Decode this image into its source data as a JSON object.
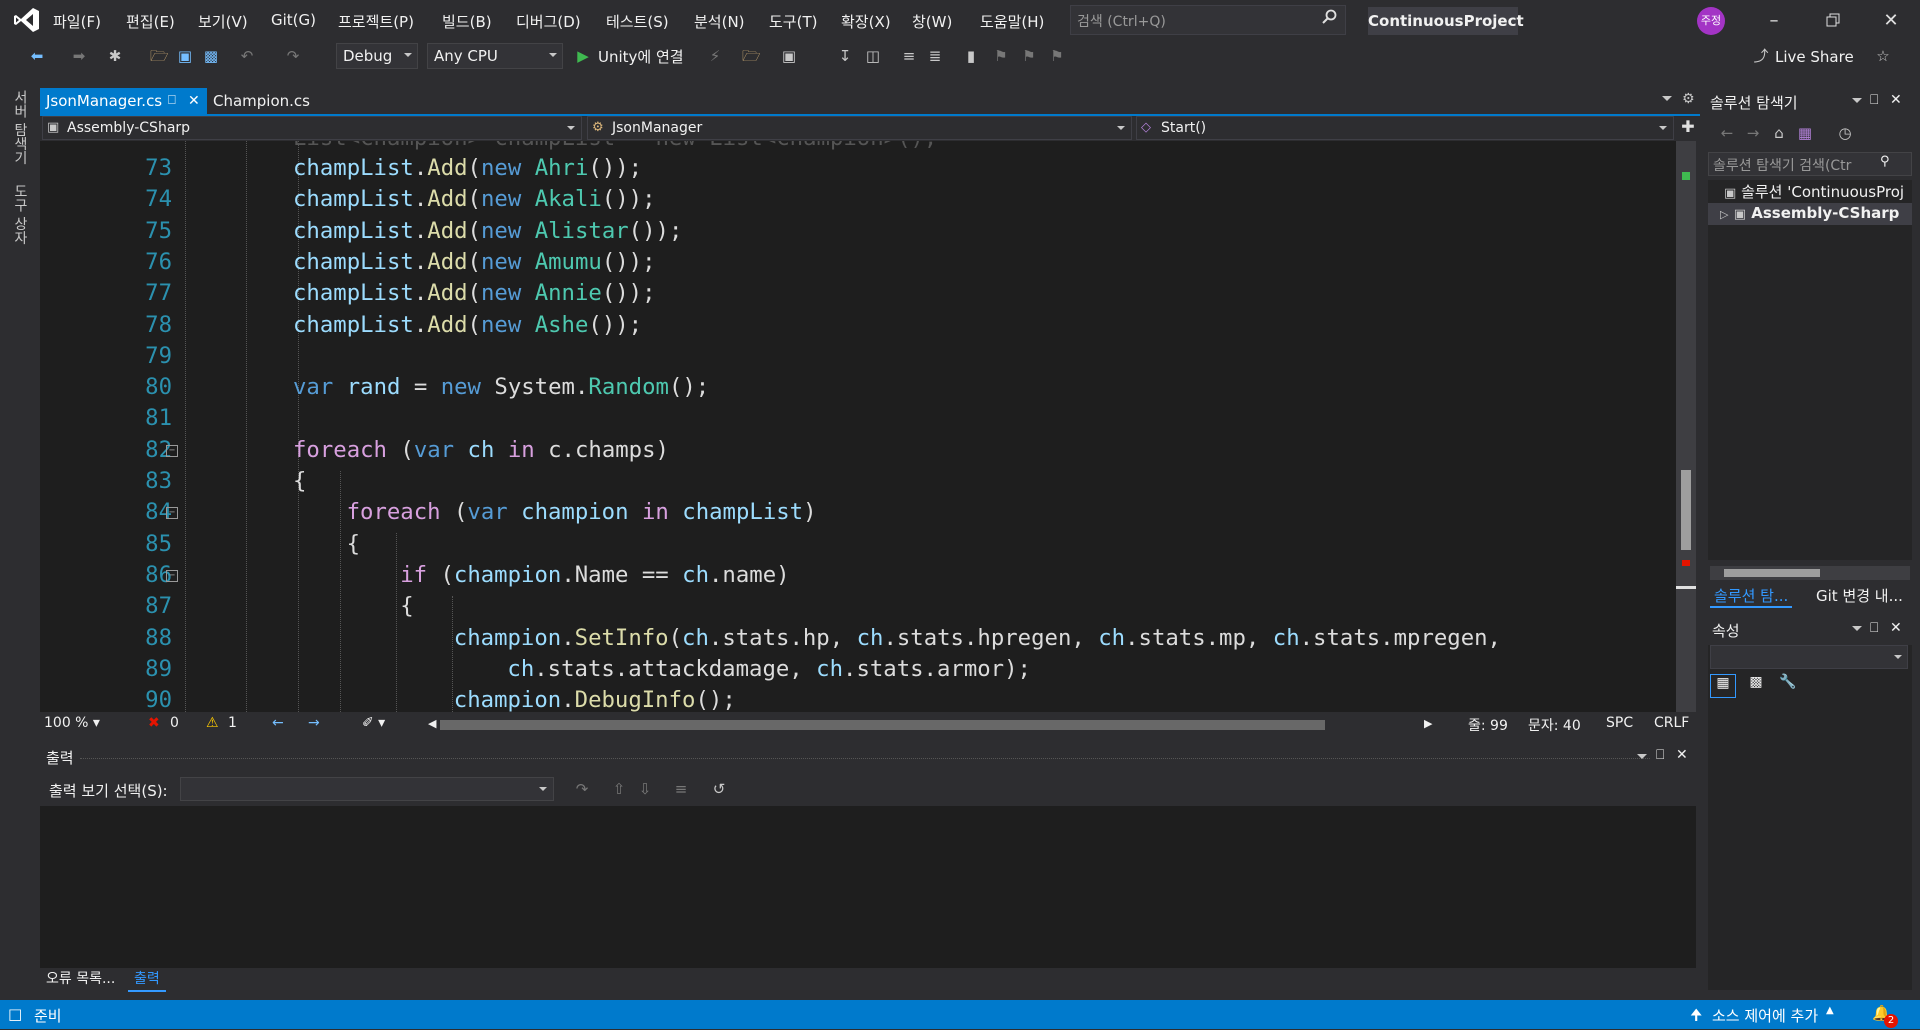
{
  "menu": [
    "파일(F)",
    "편집(E)",
    "보기(V)",
    "Git(G)",
    "프로젝트(P)",
    "빌드(B)",
    "디버그(D)",
    "테스트(S)",
    "분석(N)",
    "도구(T)",
    "확장(X)",
    "창(W)",
    "도움말(H)"
  ],
  "search": {
    "placeholder": "검색 (Ctrl+Q)"
  },
  "project_name": "ContinuousProject",
  "user_badge": "주정",
  "toolbar": {
    "config": "Debug",
    "platform": "Any CPU",
    "run_label": "Unity에 연결",
    "live_share": "Live Share"
  },
  "left_tabs": [
    "서버 탐색기",
    "도구 상자"
  ],
  "tabs": [
    {
      "label": "JsonManager.cs",
      "active": true
    },
    {
      "label": "Champion.cs",
      "active": false
    }
  ],
  "navbar": {
    "project": "Assembly-CSharp",
    "class": "JsonManager",
    "member": "Start()"
  },
  "code_lines": [
    {
      "num": "73",
      "indent": 0,
      "tokens": [
        [
          "champList",
          "loc"
        ],
        [
          ".",
          ""
        ],
        [
          "Add",
          "mth"
        ],
        [
          "(",
          ""
        ],
        [
          "new",
          "kw"
        ],
        [
          " ",
          ""
        ],
        [
          "Ahri",
          "typ"
        ],
        [
          "());",
          ""
        ]
      ]
    },
    {
      "num": "74",
      "indent": 0,
      "tokens": [
        [
          "champList",
          "loc"
        ],
        [
          ".",
          ""
        ],
        [
          "Add",
          "mth"
        ],
        [
          "(",
          ""
        ],
        [
          "new",
          "kw"
        ],
        [
          " ",
          ""
        ],
        [
          "Akali",
          "typ"
        ],
        [
          "());",
          ""
        ]
      ]
    },
    {
      "num": "75",
      "indent": 0,
      "tokens": [
        [
          "champList",
          "loc"
        ],
        [
          ".",
          ""
        ],
        [
          "Add",
          "mth"
        ],
        [
          "(",
          ""
        ],
        [
          "new",
          "kw"
        ],
        [
          " ",
          ""
        ],
        [
          "Alistar",
          "typ"
        ],
        [
          "());",
          ""
        ]
      ]
    },
    {
      "num": "76",
      "indent": 0,
      "tokens": [
        [
          "champList",
          "loc"
        ],
        [
          ".",
          ""
        ],
        [
          "Add",
          "mth"
        ],
        [
          "(",
          ""
        ],
        [
          "new",
          "kw"
        ],
        [
          " ",
          ""
        ],
        [
          "Amumu",
          "typ"
        ],
        [
          "());",
          ""
        ]
      ]
    },
    {
      "num": "77",
      "indent": 0,
      "tokens": [
        [
          "champList",
          "loc"
        ],
        [
          ".",
          ""
        ],
        [
          "Add",
          "mth"
        ],
        [
          "(",
          ""
        ],
        [
          "new",
          "kw"
        ],
        [
          " ",
          ""
        ],
        [
          "Annie",
          "typ"
        ],
        [
          "());",
          ""
        ]
      ]
    },
    {
      "num": "78",
      "indent": 0,
      "tokens": [
        [
          "champList",
          "loc"
        ],
        [
          ".",
          ""
        ],
        [
          "Add",
          "mth"
        ],
        [
          "(",
          ""
        ],
        [
          "new",
          "kw"
        ],
        [
          " ",
          ""
        ],
        [
          "Ashe",
          "typ"
        ],
        [
          "());",
          ""
        ]
      ]
    },
    {
      "num": "79",
      "indent": 0,
      "tokens": []
    },
    {
      "num": "80",
      "indent": 0,
      "tokens": [
        [
          "var",
          "kw"
        ],
        [
          " ",
          ""
        ],
        [
          "rand",
          "loc"
        ],
        [
          " = ",
          ""
        ],
        [
          "new",
          "kw"
        ],
        [
          " System.",
          ""
        ],
        [
          "Random",
          "typ"
        ],
        [
          "();",
          ""
        ]
      ]
    },
    {
      "num": "81",
      "indent": 0,
      "tokens": []
    },
    {
      "num": "82",
      "indent": 0,
      "fold": true,
      "tokens": [
        [
          "foreach",
          "ctl"
        ],
        [
          " (",
          ""
        ],
        [
          "var",
          "kw"
        ],
        [
          " ",
          ""
        ],
        [
          "ch",
          "loc"
        ],
        [
          " ",
          ""
        ],
        [
          "in",
          "ctl"
        ],
        [
          " c.champs)",
          ""
        ]
      ]
    },
    {
      "num": "83",
      "indent": 0,
      "tokens": [
        [
          "{",
          ""
        ]
      ]
    },
    {
      "num": "84",
      "indent": 1,
      "fold": true,
      "tokens": [
        [
          "foreach",
          "ctl"
        ],
        [
          " (",
          ""
        ],
        [
          "var",
          "kw"
        ],
        [
          " ",
          ""
        ],
        [
          "champion",
          "loc"
        ],
        [
          " ",
          ""
        ],
        [
          "in",
          "ctl"
        ],
        [
          " ",
          ""
        ],
        [
          "champList",
          "loc"
        ],
        [
          ")",
          ""
        ]
      ]
    },
    {
      "num": "85",
      "indent": 1,
      "tokens": [
        [
          "{",
          ""
        ]
      ]
    },
    {
      "num": "86",
      "indent": 2,
      "fold": true,
      "tokens": [
        [
          "if",
          "ctl"
        ],
        [
          " (",
          ""
        ],
        [
          "champion",
          "loc"
        ],
        [
          ".Name == ",
          ""
        ],
        [
          "ch",
          "loc"
        ],
        [
          ".name)",
          ""
        ]
      ]
    },
    {
      "num": "87",
      "indent": 2,
      "tokens": [
        [
          "{",
          ""
        ]
      ]
    },
    {
      "num": "88",
      "indent": 3,
      "tokens": [
        [
          "champion",
          "loc"
        ],
        [
          ".",
          ""
        ],
        [
          "SetInfo",
          "mth"
        ],
        [
          "(",
          ""
        ],
        [
          "ch",
          "loc"
        ],
        [
          ".stats.hp, ",
          ""
        ],
        [
          "ch",
          "loc"
        ],
        [
          ".stats.hpregen, ",
          ""
        ],
        [
          "ch",
          "loc"
        ],
        [
          ".stats.mp, ",
          ""
        ],
        [
          "ch",
          "loc"
        ],
        [
          ".stats.mpregen,",
          ""
        ]
      ]
    },
    {
      "num": "89",
      "indent": 4,
      "tokens": [
        [
          "ch",
          "loc"
        ],
        [
          ".stats.attackdamage, ",
          ""
        ],
        [
          "ch",
          "loc"
        ],
        [
          ".stats.armor);",
          ""
        ]
      ]
    },
    {
      "num": "90",
      "indent": 3,
      "tokens": [
        [
          "champion",
          "loc"
        ],
        [
          ".",
          ""
        ],
        [
          "DebugInfo",
          "mth"
        ],
        [
          "();",
          ""
        ]
      ]
    }
  ],
  "editor_status": {
    "zoom": "100 %",
    "errors": "0",
    "warnings": "1",
    "line": "줄: 99",
    "col": "문자: 40",
    "spc": "SPC",
    "crlf": "CRLF"
  },
  "output": {
    "title": "출력",
    "select_label": "출력 보기 선택(S):"
  },
  "bottom_tabs": [
    {
      "label": "오류 목록...",
      "active": false
    },
    {
      "label": "출력",
      "active": true
    }
  ],
  "solution_explorer": {
    "title": "솔루션 탐색기",
    "search_placeholder": "솔루션 탐색기 검색(Ctr",
    "solution_item": "솔루션 'ContinuousProj",
    "project_item": "Assembly-CSharp",
    "tab_solution": "솔루션 탐...",
    "tab_git": "Git 변경 내..."
  },
  "properties": {
    "title": "속성"
  },
  "status": {
    "ready": "준비",
    "source_control": "소스 제어에 추가",
    "notifications": "2"
  },
  "colors": {
    "accent": "#007acc",
    "keyword": "#569cd6",
    "control": "#d8a0df",
    "type": "#4ec9b0",
    "method": "#dcdcaa",
    "local": "#9cdcfe",
    "linenum": "#2b91af"
  }
}
